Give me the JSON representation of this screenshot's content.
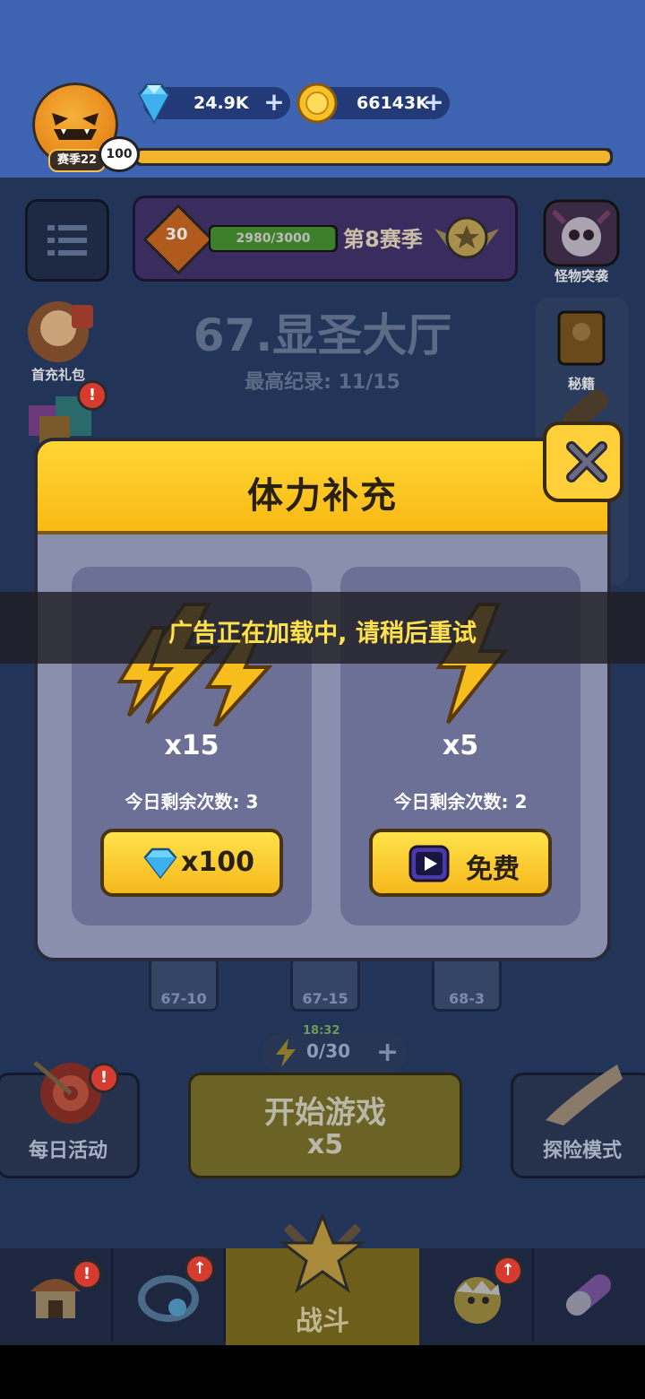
{
  "header": {
    "season_chip": "赛季22",
    "level": "100",
    "xp_progress": 1.0,
    "gems": "24.9K",
    "gold": "66143K"
  },
  "season_panel": {
    "rank": "30",
    "progress_text": "2980/3000",
    "progress": 0.993,
    "name": "第8赛季"
  },
  "side_left": [
    {
      "label": "首充礼包"
    }
  ],
  "side_right": [
    {
      "label": "怪物突袭"
    },
    {
      "label": "秘籍"
    }
  ],
  "stage": {
    "title": "67.显圣大厅",
    "record": "最高纪录: 11/15"
  },
  "stage_nodes": [
    "67-10",
    "67-15",
    "68-3"
  ],
  "energy": {
    "timer": "18:32",
    "value": "0/30"
  },
  "start": {
    "label": "开始游戏",
    "cost": "x5"
  },
  "modes": {
    "left": "每日活动",
    "right": "探险模式"
  },
  "tabbar": {
    "battle_label": "战斗"
  },
  "toast": "广告正在加载中, 请稍后重试",
  "popup": {
    "title": "体力补充",
    "cards": [
      {
        "qty": "x15",
        "remain": "今日剩余次数: 3",
        "button": "x100"
      },
      {
        "qty": "x5",
        "remain": "今日剩余次数: 2",
        "button": "免费"
      }
    ]
  },
  "colors": {
    "popup_head": "#ffd634",
    "popup_body": "#8a8fae",
    "card": "#6c7096",
    "button": "#f5b81c",
    "toast_text": "#ffe04d"
  }
}
